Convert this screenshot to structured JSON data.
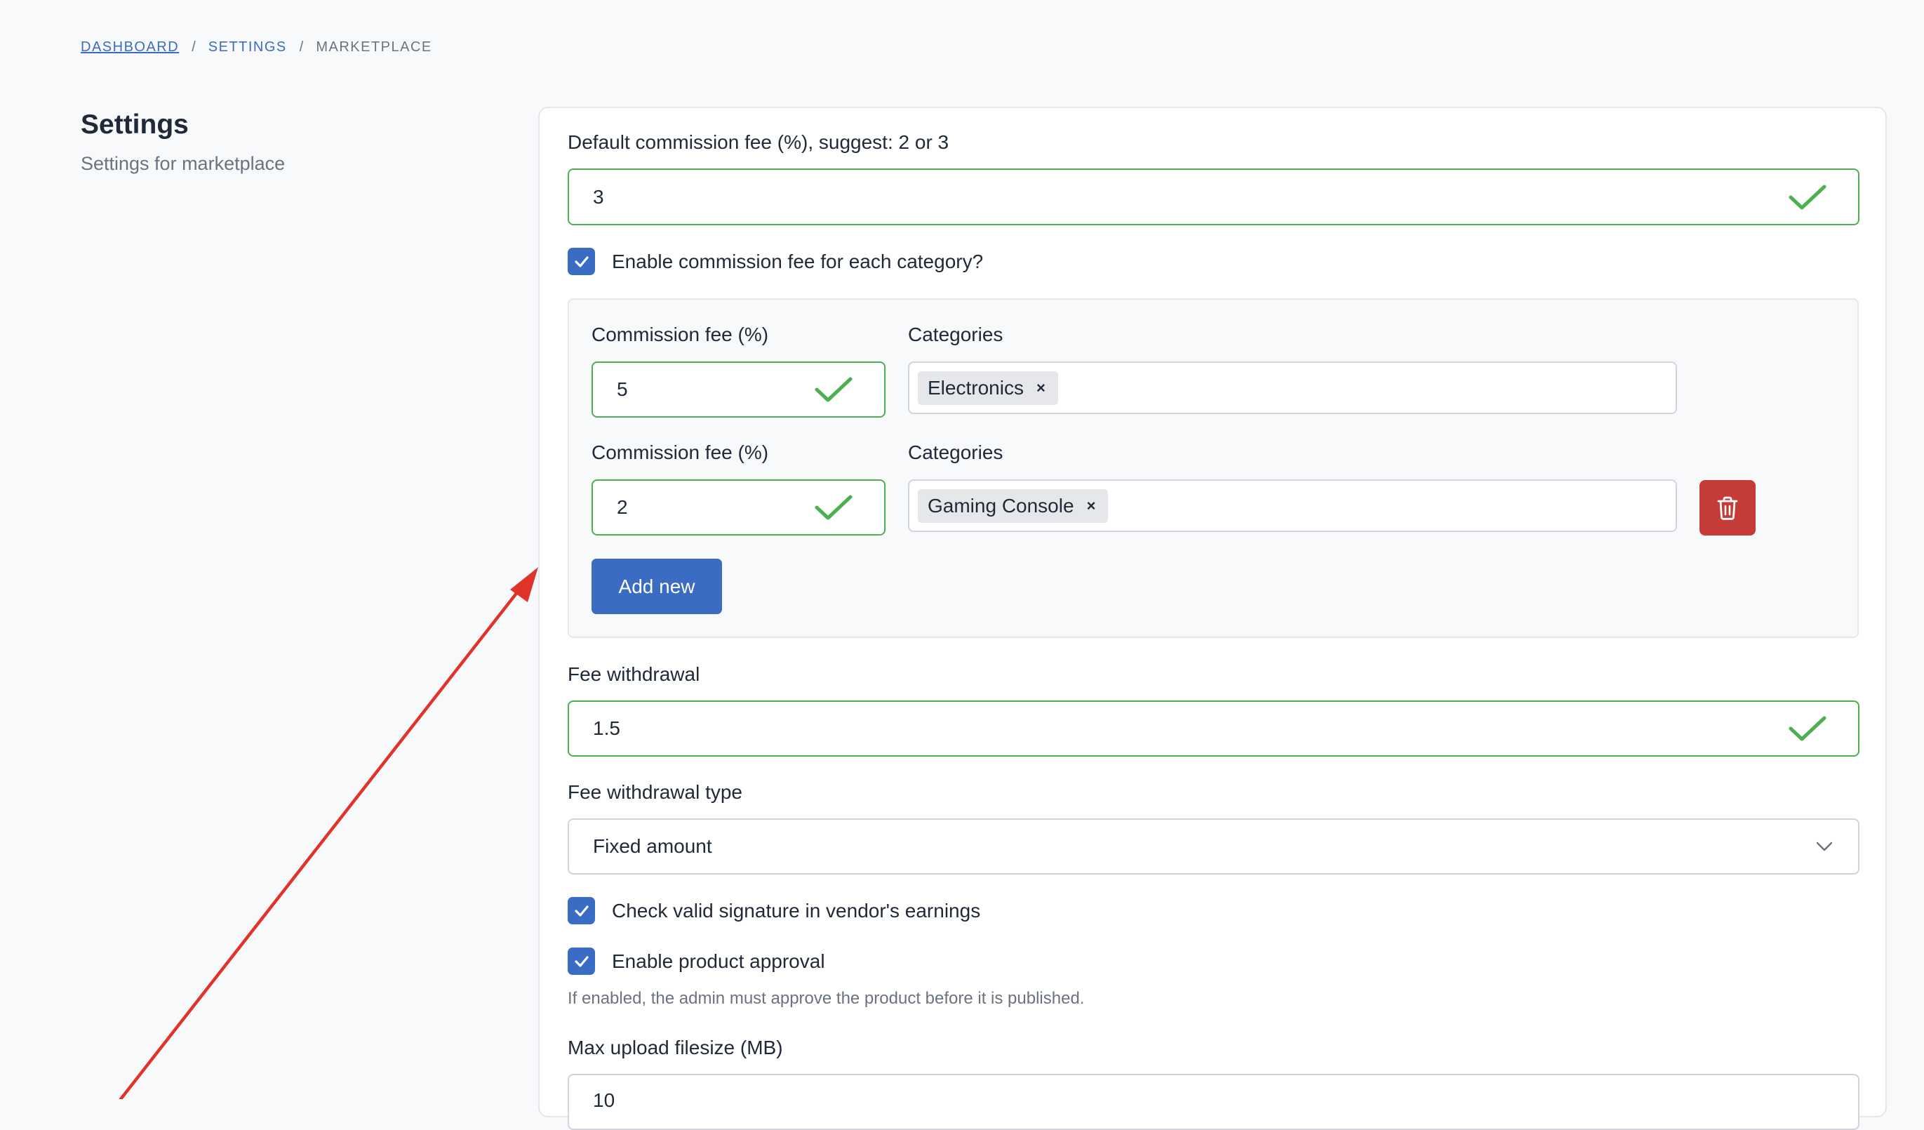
{
  "breadcrumb": {
    "items": [
      "DASHBOARD",
      "SETTINGS",
      "MARKETPLACE"
    ],
    "separator": "/"
  },
  "side": {
    "title": "Settings",
    "subtitle": "Settings for marketplace"
  },
  "form": {
    "default_fee": {
      "label": "Default commission fee (%), suggest: 2 or 3",
      "value": "3"
    },
    "enable_category_fee": {
      "label": "Enable commission fee for each category?",
      "checked": true
    },
    "category_fees": [
      {
        "fee_label": "Commission fee (%)",
        "fee_value": "5",
        "categories_label": "Categories",
        "tags": [
          "Electronics"
        ]
      },
      {
        "fee_label": "Commission fee (%)",
        "fee_value": "2",
        "categories_label": "Categories",
        "tags": [
          "Gaming Console"
        ]
      }
    ],
    "add_new_label": "Add new",
    "fee_withdrawal": {
      "label": "Fee withdrawal",
      "value": "1.5"
    },
    "fee_withdrawal_type": {
      "label": "Fee withdrawal type",
      "value": "Fixed amount"
    },
    "check_signature": {
      "label": "Check valid signature in vendor's earnings",
      "checked": true
    },
    "product_approval": {
      "label": "Enable product approval",
      "checked": true,
      "hint": "If enabled, the admin must approve the product before it is published."
    },
    "max_upload": {
      "label": "Max upload filesize (MB)",
      "value": "10"
    }
  },
  "colors": {
    "accent": "#3b6cc4",
    "valid": "#4caf50",
    "danger": "#c53b36",
    "annotation_arrow": "#e0342a"
  },
  "icons": [
    "check-icon",
    "checkbox-check-icon",
    "close-icon",
    "trash-icon",
    "chevron-down-icon"
  ]
}
